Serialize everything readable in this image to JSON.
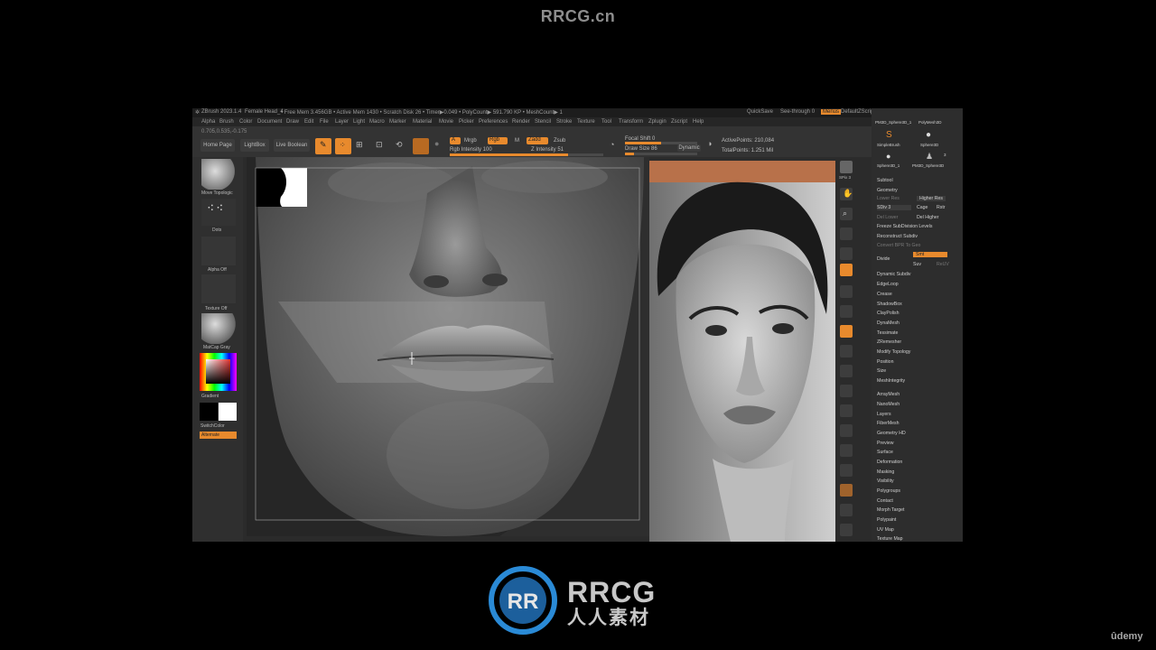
{
  "watermark": {
    "site": "RRCG.cn",
    "brand": "RRCG",
    "brand_cn": "人人素材",
    "udemy": "ûdemy"
  },
  "colors": {
    "accent": "#e88a2d",
    "panel": "#2b2b2b",
    "background": "#000000"
  },
  "titlebar": {
    "app": "ZBrush 2023.1.4",
    "doc": "Female Head_4",
    "stats": "• Free Mem 3.456GB • Active Mem 1430 • Scratch Disk 26 • Timer▶0.049 • PolyCount▶ 591.790 KP • MeshCount▶ 1",
    "quicksave": "QuickSave",
    "seethrough": "See-through  0",
    "menus": "Menus",
    "script": "DefaultZScript"
  },
  "menubar": [
    "Alpha",
    "Brush",
    "Color",
    "Document",
    "Draw",
    "Edit",
    "File",
    "Layer",
    "Light",
    "Macro",
    "Marker",
    "Material",
    "Movie",
    "Picker",
    "Preferences",
    "Render",
    "Stencil",
    "Stroke",
    "Texture",
    "Tool",
    "Transform",
    "Zplugin",
    "Zscript",
    "Help"
  ],
  "coords": "0.705,0.535,-0.175",
  "toolbar": {
    "home": "Home Page",
    "lightbox": "LightBox",
    "livebool": "Live Boolean",
    "edit": "Edit",
    "draw": "Draw",
    "move": "Move",
    "scale": "Scale",
    "rotate": "Rotate",
    "a": "A",
    "mrgb": "Mrgb",
    "rgb": "Rgb",
    "m": "M",
    "zadd": "Zadd",
    "zsub": "Zsub",
    "rgb_intensity": "Rgb Intensity 100",
    "z_intensity": "Z Intensity 51",
    "focal_shift": "Focal Shift 0",
    "draw_size": "Draw Size 86",
    "dynamic": "Dynamic",
    "active_points": "ActivePoints: 210,084",
    "total_points": "TotalPoints: 1.251 Mil"
  },
  "left_tray": {
    "brush": "Move Topologic",
    "stroke": "Dots",
    "alpha": "Alpha Off",
    "texture": "Texture Off",
    "material": "MatCap Gray",
    "gradient": "Gradient",
    "switch": "SwitchColor",
    "alternate": "Alternate"
  },
  "shelf": [
    "BPR",
    "SPix 3",
    "Scroll",
    "Zoom",
    "Actual",
    "AAHalf",
    "Persp",
    "Floor",
    "Local",
    "Gxyz",
    "Frame",
    "Move",
    "Zoom3D",
    "Rotate",
    "Line Fill",
    "PolyF",
    "Transp",
    "Ghost",
    "Solo",
    "Xpose"
  ],
  "right_tray": {
    "tools": [
      "PM3D_Sphere3D_1",
      "PolyMesh3D",
      "SimpleBrush",
      "Sphere3D",
      "Sphere3D_1",
      "PM3D_Sphere3D"
    ],
    "tool_count": "3",
    "subtool": "Subtool",
    "geometry": "Geometry",
    "lower_res": "Lower Res",
    "higher_res": "Higher Res",
    "sdiv": "SDiv 3",
    "cage": "Cage",
    "rstr": "Rstr",
    "del_lower": "Del Lower",
    "del_higher": "Del Higher",
    "freeze": "Freeze SubDivision Levels",
    "reconstruct": "Reconstruct Subdiv",
    "convert": "Convert BPR To Geo",
    "divide": "Divide",
    "smt": "Smt",
    "suv": "Suv",
    "reuv": "ReUV",
    "items": [
      "Dynamic Subdiv",
      "EdgeLoop",
      "Crease",
      "ShadowBox",
      "ClayPolish",
      "DynaMesh",
      "Tessimate",
      "ZRemesher",
      "Modify Topology",
      "Position",
      "Size",
      "MeshIntegrity"
    ],
    "sections": [
      "ArrayMesh",
      "NanoMesh",
      "Layers",
      "FiberMesh",
      "Geometry HD",
      "Preview",
      "Surface",
      "Deformation",
      "Masking",
      "Visibility",
      "Polygroups",
      "Contact",
      "Morph Target",
      "Polypaint",
      "UV Map",
      "Texture Map"
    ]
  }
}
